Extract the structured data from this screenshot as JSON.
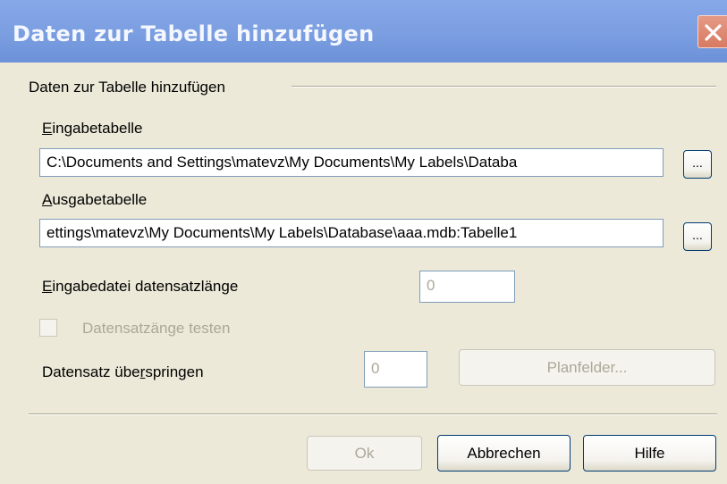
{
  "window": {
    "title": "Daten zur Tabelle hinzufügen",
    "close_glyph": "✕"
  },
  "group": {
    "label": "Daten zur Tabelle hinzufügen"
  },
  "input_table": {
    "label_mnemonic": "E",
    "label_rest": "ingabetabelle",
    "value": "C:\\Documents and Settings\\matevz\\My Documents\\My Labels\\Databa",
    "browse_label": "..."
  },
  "output_table": {
    "label_mnemonic": "A",
    "label_rest": "usgabetabelle",
    "value": "ettings\\matevz\\My Documents\\My Labels\\Database\\aaa.mdb:Tabelle1",
    "browse_label": "..."
  },
  "record_length": {
    "label_mnemonic": "E",
    "label_rest": "ingabedatei datensatzlänge",
    "value": "0"
  },
  "test_length": {
    "label": "Datensatzänge testen",
    "checked": false
  },
  "skip_records": {
    "label_before": "Datensatz übe",
    "label_mnemonic": "r",
    "label_after": "springen",
    "value": "0"
  },
  "buttons": {
    "map_fields": "Planfelder...",
    "ok": "Ok",
    "cancel": "Abbrechen",
    "help": "Hilfe"
  },
  "colors": {
    "titlebar": "#7C9FE2",
    "close_button": "#D87A63",
    "dialog_background": "#ECE9D8",
    "button_border": "#003C74",
    "disabled_text": "#ACA899"
  }
}
